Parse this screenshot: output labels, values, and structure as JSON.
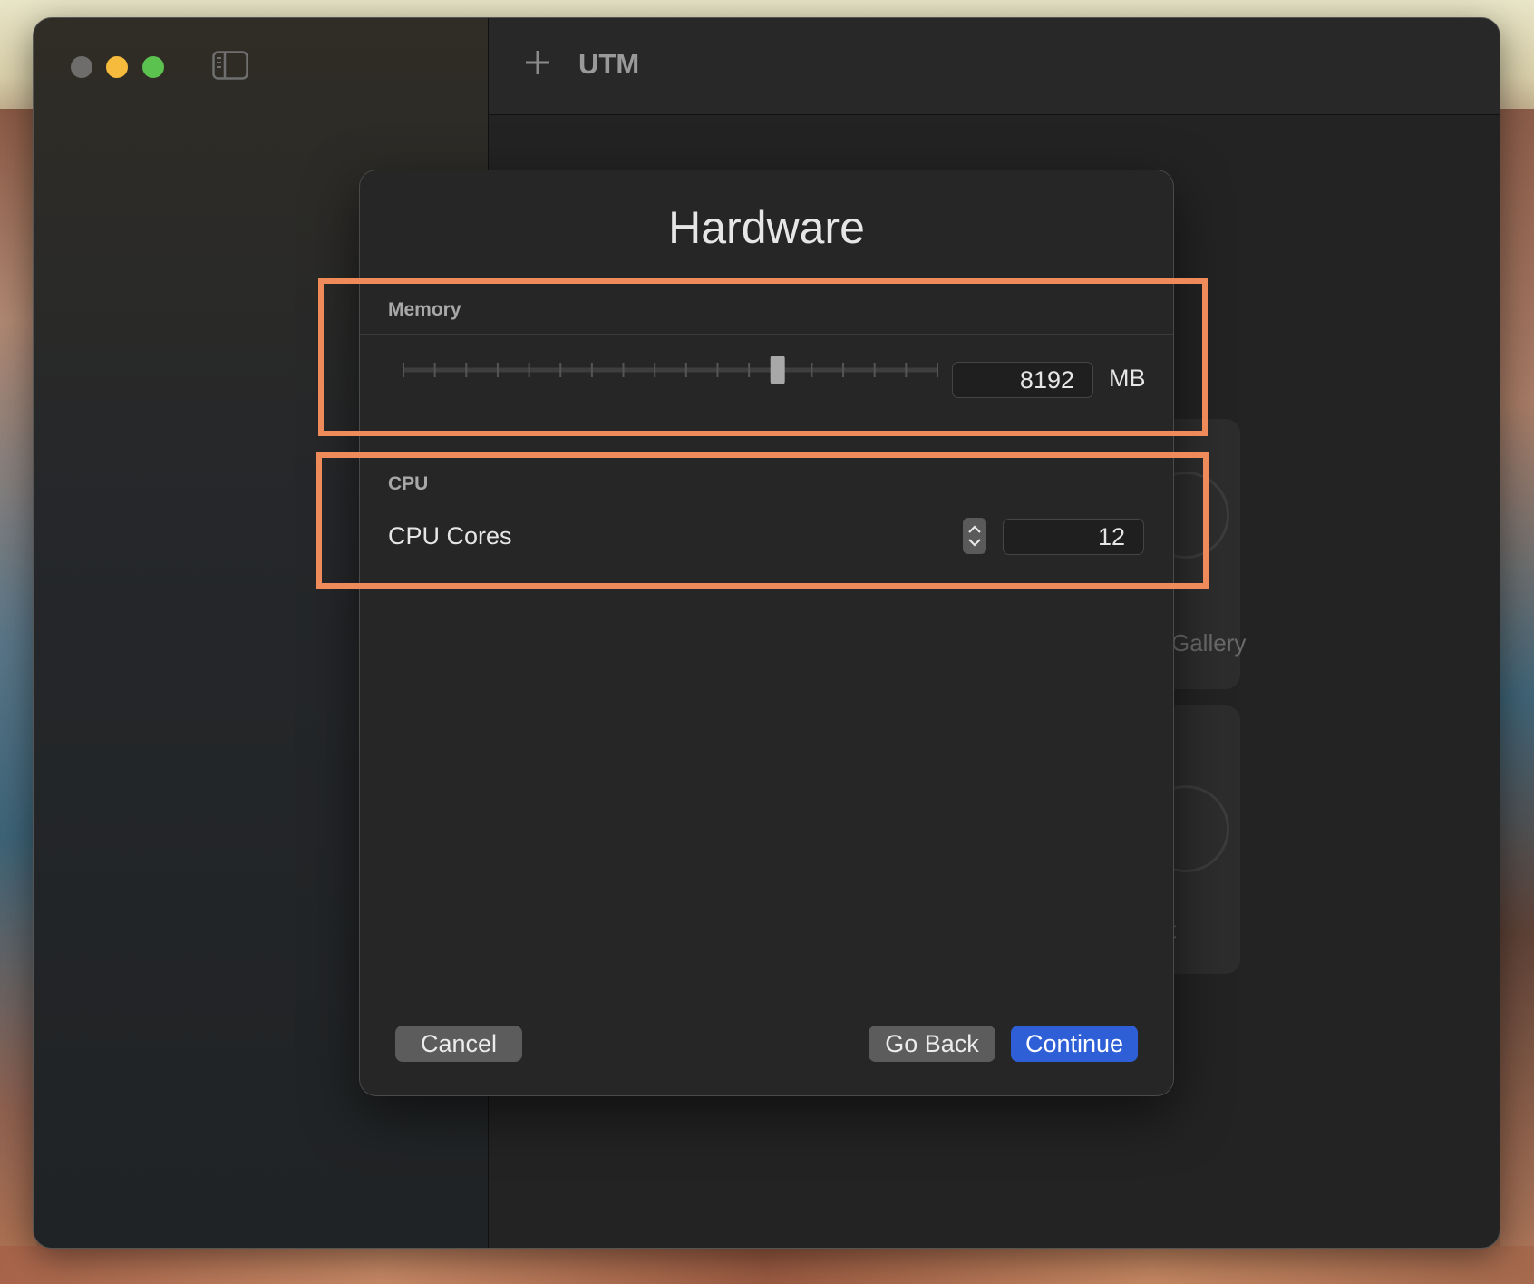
{
  "window": {
    "title": "UTM",
    "add_icon": "plus-icon",
    "sidebar_toggle_icon": "sidebar-toggle-icon"
  },
  "background_cards": {
    "gallery_label": "Gallery",
    "second_label_fragment": "t"
  },
  "dialog": {
    "title": "Hardware",
    "memory": {
      "section_label": "Memory",
      "value": "8192",
      "unit": "MB",
      "slider_fraction": 0.7
    },
    "cpu": {
      "section_label": "CPU",
      "cores_label": "CPU Cores",
      "cores_value": "12"
    },
    "buttons": {
      "cancel": "Cancel",
      "go_back": "Go Back",
      "continue": "Continue"
    }
  },
  "colors": {
    "accent": "#2e5fd6",
    "highlight": "#ef8a5a"
  }
}
